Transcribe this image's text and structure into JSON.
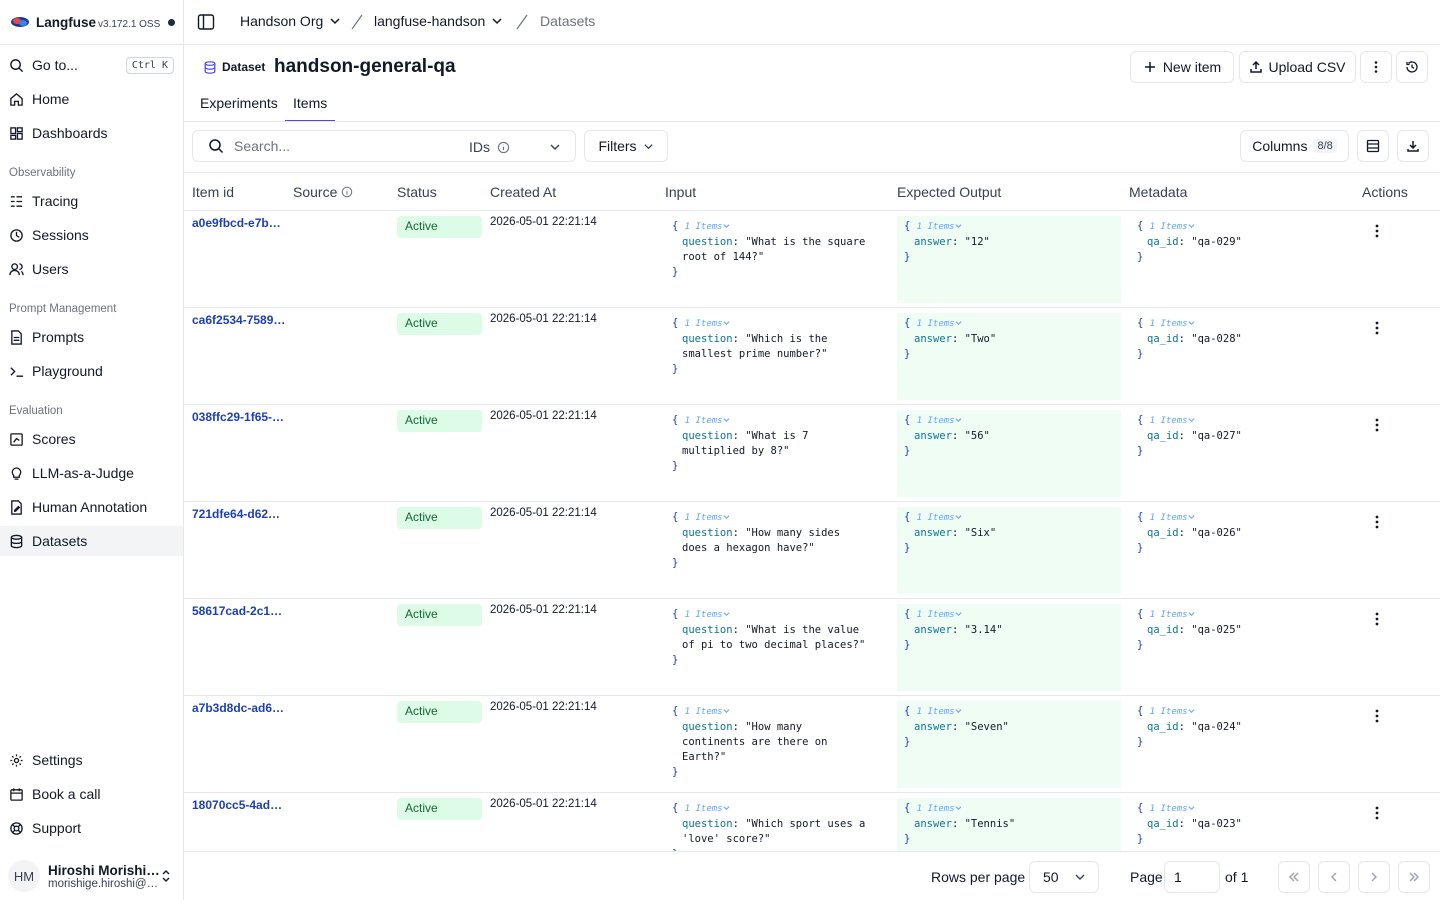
{
  "app": {
    "name": "Langfuse",
    "version": "v3.172.1 OSS"
  },
  "sidebar": {
    "goto": {
      "label": "Go to...",
      "shortcut": "Ctrl K"
    },
    "top_items": [
      {
        "label": "Home",
        "icon": "home-icon"
      },
      {
        "label": "Dashboards",
        "icon": "dashboard-icon"
      }
    ],
    "groups": [
      {
        "title": "Observability",
        "items": [
          {
            "label": "Tracing",
            "icon": "tracing-icon"
          },
          {
            "label": "Sessions",
            "icon": "clock-icon"
          },
          {
            "label": "Users",
            "icon": "users-icon"
          }
        ]
      },
      {
        "title": "Prompt Management",
        "items": [
          {
            "label": "Prompts",
            "icon": "file-icon"
          },
          {
            "label": "Playground",
            "icon": "terminal-icon"
          }
        ]
      },
      {
        "title": "Evaluation",
        "items": [
          {
            "label": "Scores",
            "icon": "scores-icon"
          },
          {
            "label": "LLM-as-a-Judge",
            "icon": "lightbulb-icon"
          },
          {
            "label": "Human Annotation",
            "icon": "annotation-icon"
          },
          {
            "label": "Datasets",
            "icon": "database-icon",
            "active": true
          }
        ]
      }
    ],
    "bottom_items": [
      {
        "label": "Settings",
        "icon": "gear-icon"
      },
      {
        "label": "Book a call",
        "icon": "calendar-icon"
      },
      {
        "label": "Support",
        "icon": "lifebuoy-icon"
      }
    ],
    "user": {
      "initials": "HM",
      "name": "Hiroshi Morishige",
      "email": "morishige.hiroshi@handson.example"
    }
  },
  "topbar": {
    "org": "Handson Org",
    "project": "langfuse-handson",
    "page": "Datasets"
  },
  "header": {
    "type_label": "Dataset",
    "title": "handson-general-qa",
    "new_item": "New item",
    "upload_csv": "Upload CSV"
  },
  "tabs": [
    {
      "label": "Experiments",
      "active": false
    },
    {
      "label": "Items",
      "active": true
    }
  ],
  "toolbar": {
    "search_placeholder": "Search...",
    "ids_label": "IDs",
    "filters_label": "Filters",
    "columns_label": "Columns",
    "columns_count": "8/8"
  },
  "table": {
    "columns": [
      "Item id",
      "Source",
      "Status",
      "Created At",
      "Input",
      "Expected Output",
      "Metadata",
      "Actions"
    ],
    "rows": [
      {
        "id": "a0e9fbcd-e7b…",
        "status": "Active",
        "created": "2026-05-01 22:21:14",
        "input_count": "1 Items",
        "input_key": "question",
        "input_lines": [
          "\"What is the square",
          "root of 144?\""
        ],
        "output_count": "1 Items",
        "output_key": "answer",
        "output_value": "\"12\"",
        "meta_count": "1 Items",
        "meta_key": "qa_id",
        "meta_value": "\"qa-029\""
      },
      {
        "id": "ca6f2534-7589…",
        "status": "Active",
        "created": "2026-05-01 22:21:14",
        "input_count": "1 Items",
        "input_key": "question",
        "input_lines": [
          "\"Which is the",
          "smallest prime number?\""
        ],
        "output_count": "1 Items",
        "output_key": "answer",
        "output_value": "\"Two\"",
        "meta_count": "1 Items",
        "meta_key": "qa_id",
        "meta_value": "\"qa-028\""
      },
      {
        "id": "038ffc29-1f65-…",
        "status": "Active",
        "created": "2026-05-01 22:21:14",
        "input_count": "1 Items",
        "input_key": "question",
        "input_lines": [
          "\"What is 7",
          "multiplied by 8?\""
        ],
        "output_count": "1 Items",
        "output_key": "answer",
        "output_value": "\"56\"",
        "meta_count": "1 Items",
        "meta_key": "qa_id",
        "meta_value": "\"qa-027\""
      },
      {
        "id": "721dfe64-d62…",
        "status": "Active",
        "created": "2026-05-01 22:21:14",
        "input_count": "1 Items",
        "input_key": "question",
        "input_lines": [
          "\"How many sides",
          "does a hexagon have?\""
        ],
        "output_count": "1 Items",
        "output_key": "answer",
        "output_value": "\"Six\"",
        "meta_count": "1 Items",
        "meta_key": "qa_id",
        "meta_value": "\"qa-026\""
      },
      {
        "id": "58617cad-2c1…",
        "status": "Active",
        "created": "2026-05-01 22:21:14",
        "input_count": "1 Items",
        "input_key": "question",
        "input_lines": [
          "\"What is the value",
          "of pi to two decimal places?\""
        ],
        "output_count": "1 Items",
        "output_key": "answer",
        "output_value": "\"3.14\"",
        "meta_count": "1 Items",
        "meta_key": "qa_id",
        "meta_value": "\"qa-025\""
      },
      {
        "id": "a7b3d8dc-ad6…",
        "status": "Active",
        "created": "2026-05-01 22:21:14",
        "input_count": "1 Items",
        "input_key": "question",
        "input_lines": [
          "\"How many",
          "continents are there on",
          "Earth?\""
        ],
        "output_count": "1 Items",
        "output_key": "answer",
        "output_value": "\"Seven\"",
        "meta_count": "1 Items",
        "meta_key": "qa_id",
        "meta_value": "\"qa-024\""
      },
      {
        "id": "18070cc5-4adc…",
        "status": "Active",
        "created": "2026-05-01 22:21:14",
        "input_count": "1 Items",
        "input_key": "question",
        "input_lines": [
          "\"Which sport uses a",
          "'love' score?\""
        ],
        "output_count": "1 Items",
        "output_key": "answer",
        "output_value": "\"Tennis\"",
        "meta_count": "1 Items",
        "meta_key": "qa_id",
        "meta_value": "\"qa-023\""
      }
    ]
  },
  "footer": {
    "rows_per_page_label": "Rows per page",
    "rows_per_page": "50",
    "page_label": "Page",
    "page": "1",
    "of_label": "of 1"
  },
  "colors": {
    "accent": "#4f46e5",
    "status_bg": "#dcfce7",
    "status_text": "#166534",
    "link": "#1e40af",
    "expected_bg": "#f0fdf4"
  }
}
